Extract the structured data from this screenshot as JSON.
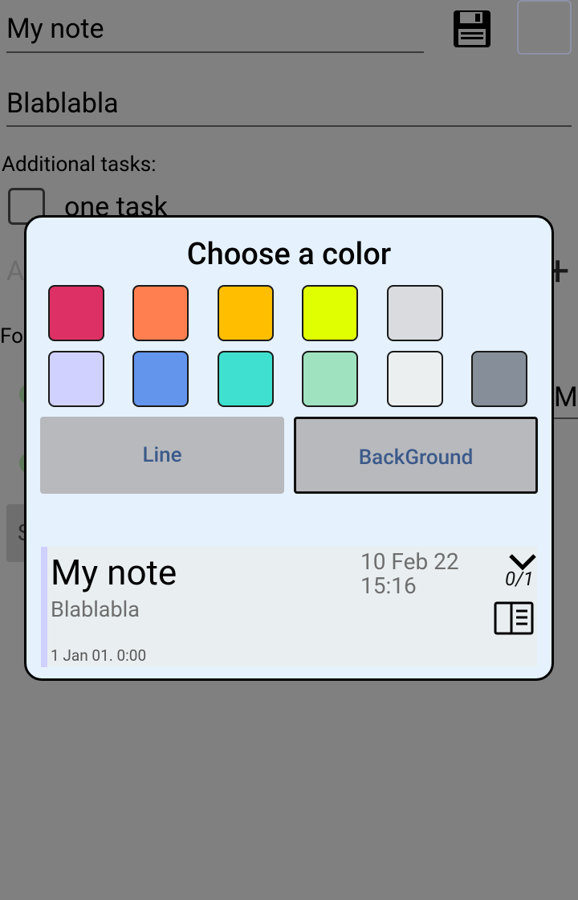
{
  "editor": {
    "title": "My note",
    "description": "Blablabla",
    "tasks_label": "Additional tasks:",
    "task_items": [
      {
        "label": "one task",
        "checked": false
      }
    ],
    "add_task_placeholder": "A",
    "add_task_plus": "+",
    "fo_label": "Fo",
    "m_text": "M",
    "s_button_label": "S",
    "current_color": "#808080"
  },
  "color_dialog": {
    "title": "Choose a color",
    "swatches_row1": [
      "#dd3064",
      "#ff7f50",
      "#ffbf00",
      "#e0ff00",
      "#d9dbde"
    ],
    "swatches_row2": [
      "#d1d1ff",
      "#6495ed",
      "#40e0d0",
      "#9fe2bf",
      "#eceff0",
      "#868f99"
    ],
    "mode_buttons": {
      "line": "Line",
      "background": "BackGround",
      "selected": "background"
    },
    "preview": {
      "title": "My note",
      "description": "Blablabla",
      "date_line1": "10 Feb 22",
      "date_line2": "15:16",
      "progress": "0/1",
      "created": "1 Jan 01. 0:00",
      "line_color": "#d0d0ff",
      "background_color": "#e9eef0"
    }
  }
}
